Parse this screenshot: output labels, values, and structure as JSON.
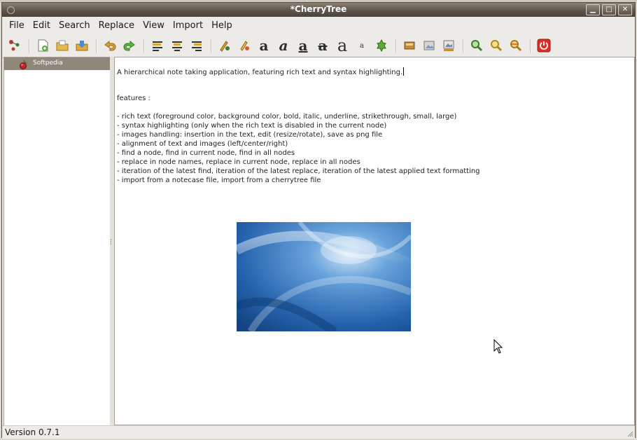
{
  "window": {
    "title": "*CherryTree"
  },
  "window_controls": {
    "minimize": "▁",
    "maximize": "□",
    "close": "✕"
  },
  "menu": {
    "file": "File",
    "edit": "Edit",
    "search": "Search",
    "replace": "Replace",
    "view": "View",
    "import": "Import",
    "help": "Help"
  },
  "toolbar": {
    "bold_glyph": "a",
    "italic_glyph": "a",
    "underline_glyph": "a",
    "strikethrough_glyph": "a",
    "large_glyph": "a",
    "small_glyph": "a"
  },
  "tree": {
    "nodes": [
      {
        "label": "Softpedia"
      }
    ]
  },
  "editor": {
    "intro": "A hierarchical note taking application, featuring rich text and syntax highlighting.",
    "features_heading": "features :",
    "features": [
      "- rich text (foreground color, background color, bold, italic, underline, strikethrough, small, large)",
      "- syntax highlighting (only when the rich text is disabled in the current node)",
      "- images handling: insertion in the text, edit (resize/rotate), save as png file",
      "- alignment of text and images (left/center/right)",
      "- find a node, find in current node, find in all nodes",
      "- replace in node names, replace in current node, replace in all nodes",
      "- iteration of the latest find, iteration of the latest replace, iteration of the latest applied text formatting",
      "- import from a notecase file, import from a cherrytree file"
    ]
  },
  "status": {
    "version": "Version 0.7.1"
  },
  "colors": {
    "selection": "#8f8779",
    "titlebar": "#5e554a",
    "picture_blue": "#2f6fb5",
    "quit_red": "#d9302a"
  }
}
